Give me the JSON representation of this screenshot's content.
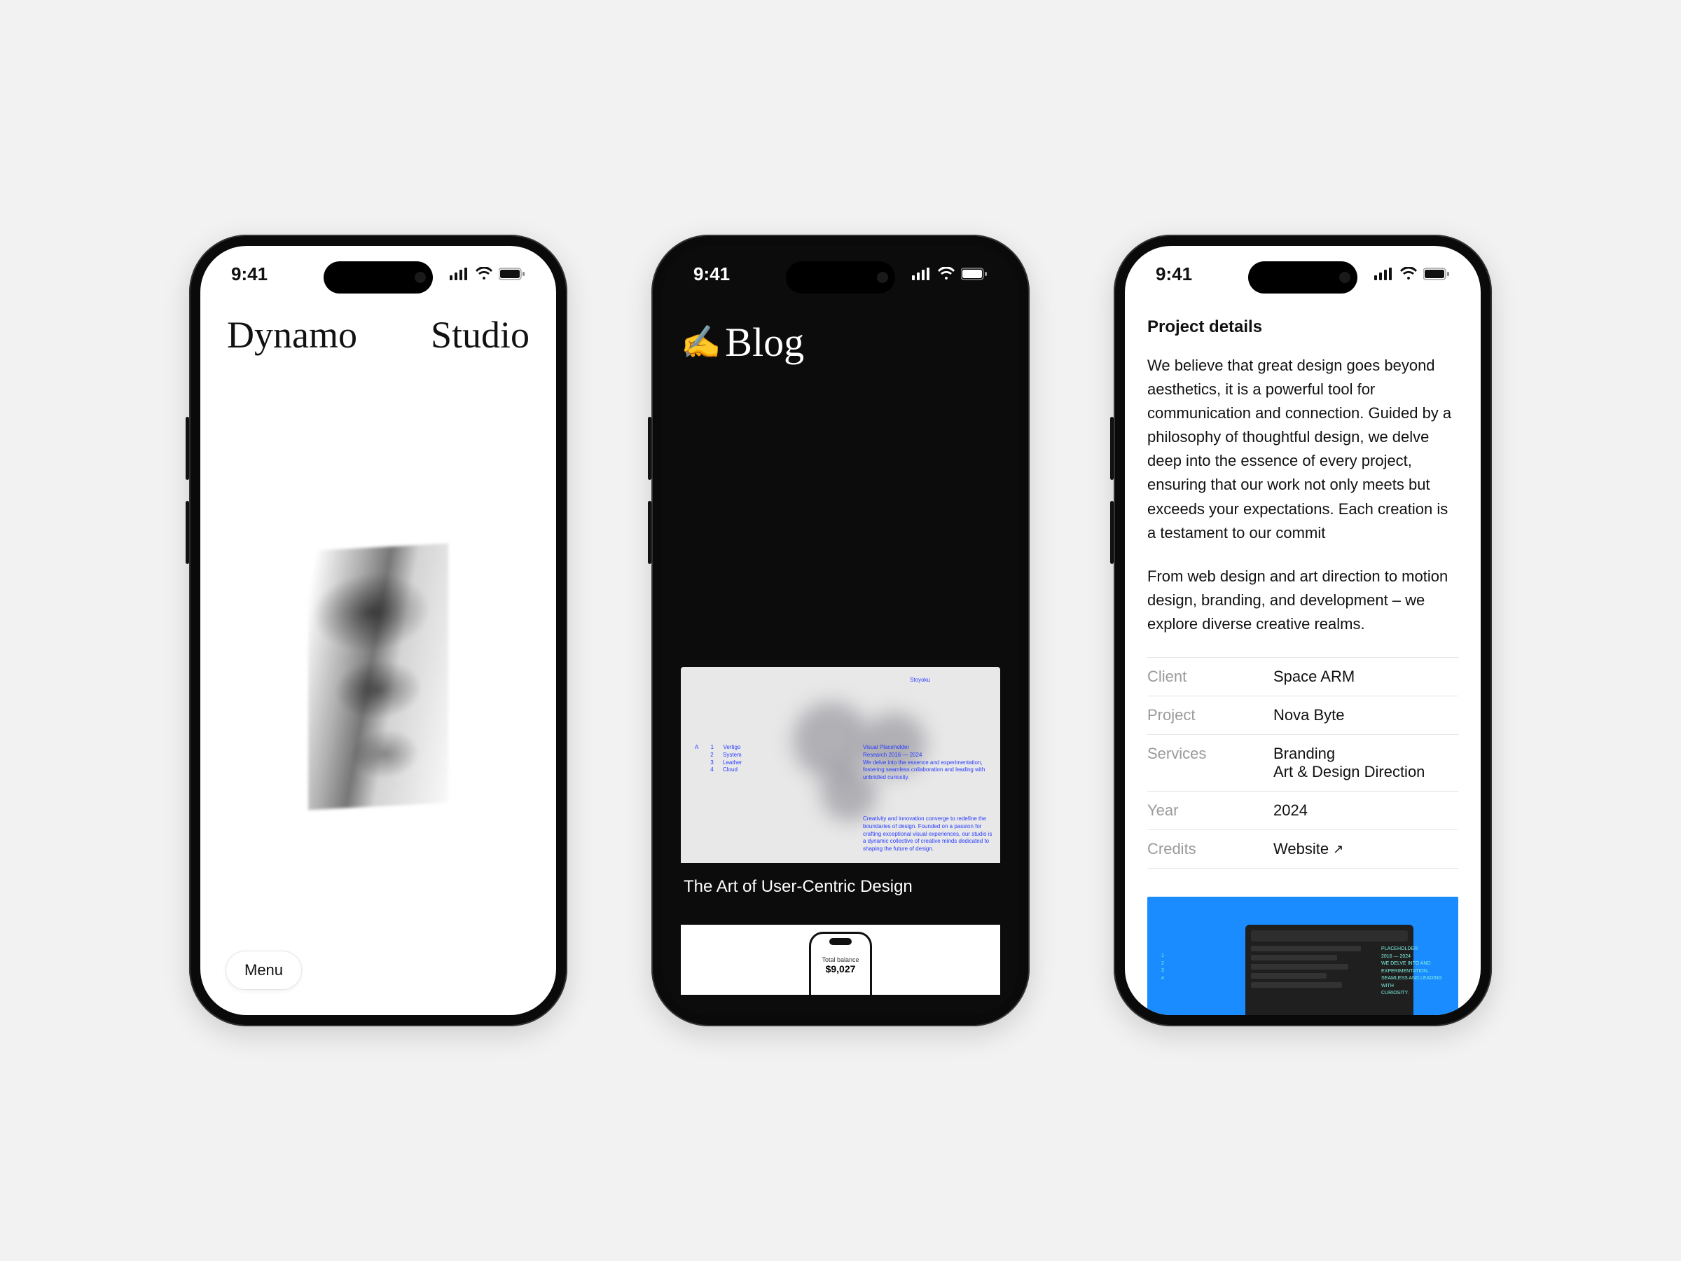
{
  "statusbar": {
    "time": "9:41"
  },
  "phone1": {
    "brand_left": "Dynamo",
    "brand_right": "Studio",
    "menu_label": "Menu"
  },
  "phone2": {
    "emoji": "✍️",
    "title": "Blog",
    "card1": {
      "title": "The Art of User-Centric Design",
      "thumb_header": "Stoyoku",
      "left_col": "A        1      Vertigo\n          2      System\n          3      Leather\n          4      Cloud",
      "mid_col": "Visual         Placeholder\nResearch    2016 — 2024\nWe delve into the essence and experimentation, fostering seamless collaboration and leading with unbridled curiosity.",
      "bottom_col": "Creativity and innovation converge to redefine the boundaries of design. Founded on a passion for crafting exceptional visual experiences, our studio is a dynamic collective of creative minds dedicated to shaping the future of design."
    },
    "card2": {
      "mini_label": "Total balance",
      "mini_value": "$9,027"
    }
  },
  "phone3": {
    "heading": "Project details",
    "para1": "We believe that great design goes beyond aesthetics, it is a powerful tool for communication and connection. Guided by a philosophy of thoughtful design, we delve deep into the essence of every project, ensuring that our work not only meets but exceeds your expectations. Each creation is a testament to our commit",
    "para2": "From web design and art direction to motion design, branding, and development – we explore diverse creative realms.",
    "meta": [
      {
        "label": "Client",
        "value": "Space ARM"
      },
      {
        "label": "Project",
        "value": "Nova Byte"
      },
      {
        "label": "Services",
        "value": "Branding\nArt & Design Direction"
      },
      {
        "label": "Year",
        "value": "2024"
      },
      {
        "label": "Credits",
        "value": "Website",
        "link": true
      }
    ]
  }
}
